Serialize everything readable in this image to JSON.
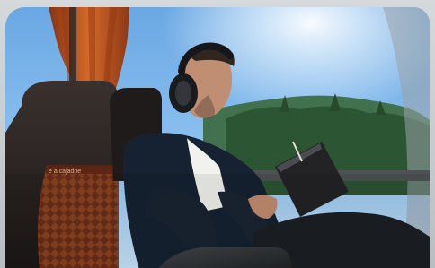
{
  "scene": {
    "seat_embroidery": "e a cajadhe",
    "palette": {
      "sky_top": "#6ea9e4",
      "sky_mid": "#8cc0f0",
      "sky_bottom": "#b7dbf7",
      "trees": "#2f5d38",
      "curtain": "#c4571e",
      "headrest": "#2a2523",
      "seat_pattern": "#7a3419",
      "shirt": "#1a2432",
      "headphones": "#1b1c20",
      "book": "#242325",
      "skin": "#b98668"
    },
    "icons": {
      "headphones": "headphones-icon",
      "book": "book-icon"
    }
  }
}
